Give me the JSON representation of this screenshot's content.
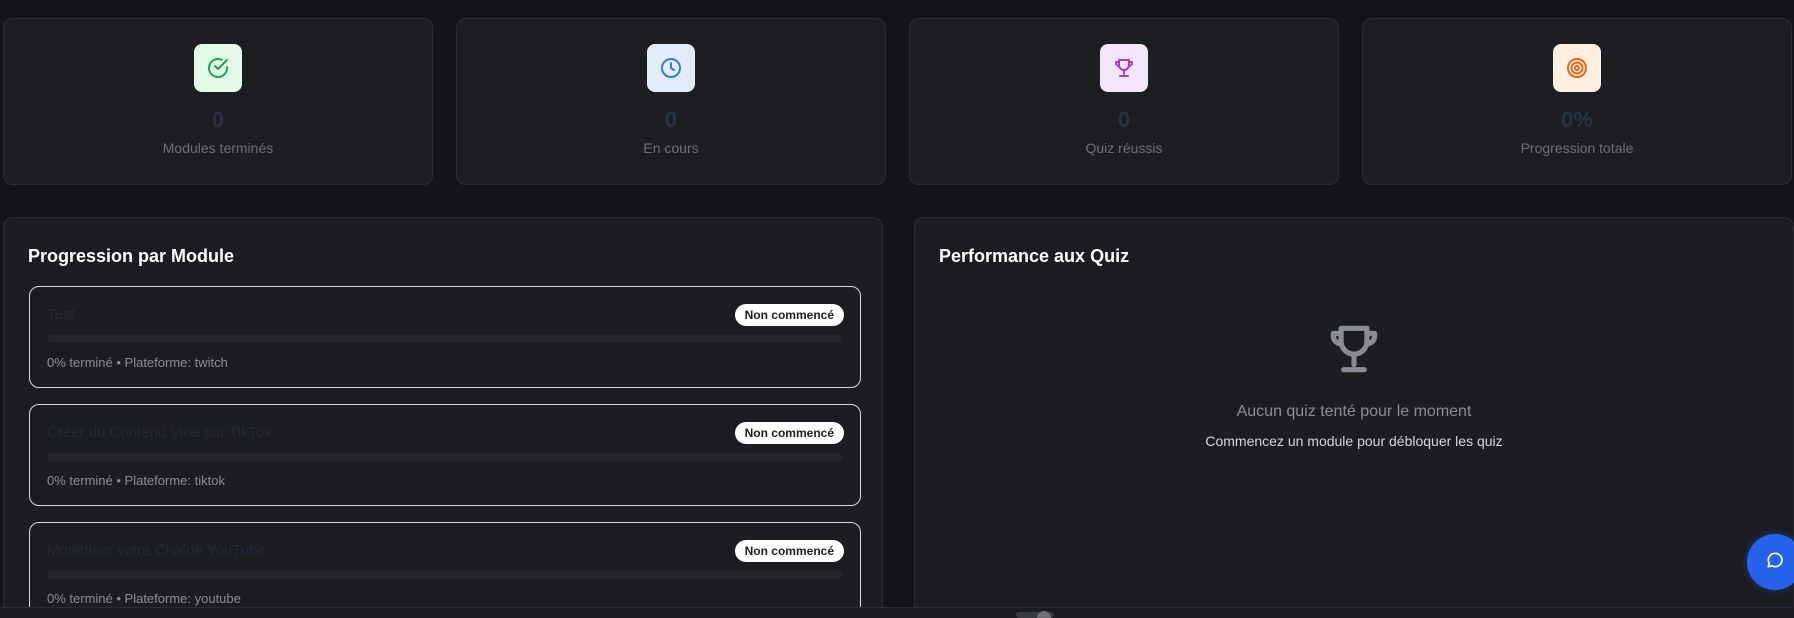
{
  "stats": [
    {
      "icon": "check-circle-icon",
      "value": "0",
      "label": "Modules terminés",
      "icon_bg": "#e3fae9",
      "icon_color": "#22a34a"
    },
    {
      "icon": "clock-icon",
      "value": "0",
      "label": "En cours",
      "icon_bg": "#e2ecfb",
      "icon_color": "#2f7fe0"
    },
    {
      "icon": "trophy-icon",
      "value": "0",
      "label": "Quiz réussis",
      "icon_bg": "#f3e6fb",
      "icon_color": "#9b3fd6"
    },
    {
      "icon": "target-icon",
      "value": "0%",
      "label": "Progression totale",
      "icon_bg": "#fdeede",
      "icon_color": "#e36a1e"
    }
  ],
  "progress_panel": {
    "title": "Progression par Module",
    "modules": [
      {
        "title": "Test",
        "status": "Non commencé",
        "progress": 0,
        "meta": "0% terminé • Plateforme: twitch"
      },
      {
        "title": "Créer du Contenu Viral sur TikTok",
        "status": "Non commencé",
        "progress": 0,
        "meta": "0% terminé • Plateforme: tiktok"
      },
      {
        "title": "Monétiser votre Chaîne YouTube",
        "status": "Non commencé",
        "progress": 0,
        "meta": "0% terminé • Plateforme: youtube"
      }
    ]
  },
  "quiz_panel": {
    "title": "Performance aux Quiz",
    "empty_icon": "trophy-icon",
    "empty_title": "Aucun quiz tenté pour le moment",
    "empty_subtitle": "Commencez un module pour débloquer les quiz"
  },
  "chat_button": {
    "icon": "chat-bubble-icon",
    "color": "#2563eb"
  }
}
